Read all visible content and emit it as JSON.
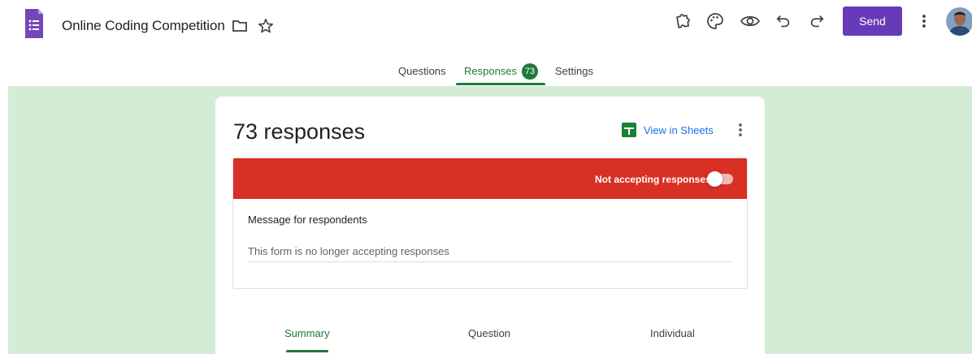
{
  "header": {
    "title": "Online Coding Competition",
    "send_label": "Send",
    "icons": {
      "logo": "google-forms-icon",
      "folder": "folder-icon",
      "star": "star-icon",
      "addon": "puzzle-icon",
      "palette": "palette-icon",
      "preview": "eye-icon",
      "undo": "undo-icon",
      "redo": "redo-icon",
      "more": "more-vert-icon"
    }
  },
  "tabs": [
    {
      "label": "Questions"
    },
    {
      "label": "Responses",
      "badge": "73",
      "active": true
    },
    {
      "label": "Settings"
    }
  ],
  "card": {
    "count_label": "73 responses",
    "sheets_label": "View in Sheets",
    "status_text": "Not accepting responses",
    "accepting": false,
    "message_title": "Message for respondents",
    "message_value": "This form is no longer accepting responses"
  },
  "subtabs": [
    {
      "label": "Summary",
      "active": true
    },
    {
      "label": "Question"
    },
    {
      "label": "Individual"
    }
  ],
  "colors": {
    "primary": "#673ab7",
    "accent_green": "#1e7a3a",
    "background": "#d4ecd6",
    "banner_red": "#d93025"
  }
}
